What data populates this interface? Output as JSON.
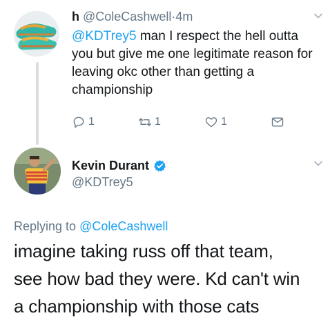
{
  "tweet1": {
    "name": "h",
    "handle": "@ColeCashwell",
    "separator": "·",
    "time": "4m",
    "mention": "@KDTrey5",
    "text": " man I respect the hell outta you but give me one legitimate reason for leaving okc other than getting a championship",
    "actions": {
      "reply_count": "1",
      "retweet_count": "1",
      "like_count": "1"
    },
    "icons": [
      "reply-icon",
      "retweet-icon",
      "like-icon",
      "message-icon",
      "chevron-down-icon"
    ]
  },
  "tweet2": {
    "name": "Kevin Durant",
    "handle": "@KDTrey5",
    "verified": true,
    "replying_prefix": "Replying to ",
    "replying_to": "@ColeCashwell",
    "text_lines": [
      "imagine taking russ off that team,",
      "see how bad they were. Kd can't win",
      "a championship with those cats"
    ]
  },
  "colors": {
    "link": "#1da1f2",
    "secondary": "#657786",
    "primary": "#14171a",
    "thread_line": "#d9dee2"
  }
}
